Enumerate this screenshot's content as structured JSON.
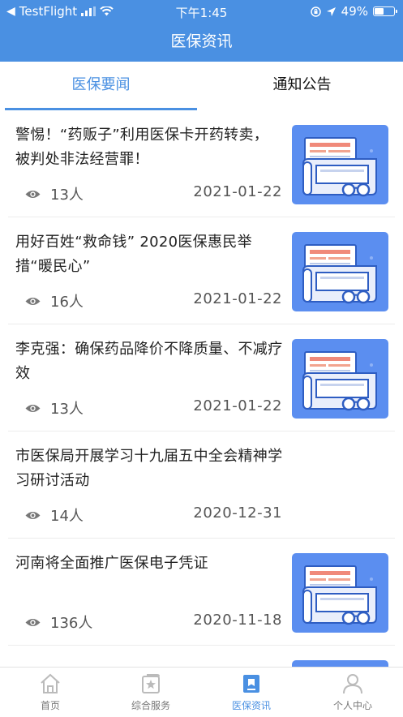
{
  "status_bar": {
    "back_app": "TestFlight",
    "time": "下午1:45",
    "battery": "49%",
    "battery_level": 0.49
  },
  "header": {
    "title": "医保资讯"
  },
  "tabs": [
    {
      "label": "医保要闻",
      "active": true
    },
    {
      "label": "通知公告",
      "active": false
    }
  ],
  "news": [
    {
      "title": "警惕！“药贩子”利用医保卡开药转卖，被判处非法经营罪！",
      "views": "13人",
      "date": "2021-01-22",
      "thumbnail": true
    },
    {
      "title": "用好百姓“救命钱” 2020医保惠民举措“暖民心”",
      "views": "16人",
      "date": "2021-01-22",
      "thumbnail": true
    },
    {
      "title": "李克强：确保药品降价不降质量、不减疗效",
      "views": "13人",
      "date": "2021-01-22",
      "thumbnail": true
    },
    {
      "title": "市医保局开展学习十九届五中全会精神学习研讨活动",
      "views": "14人",
      "date": "2020-12-31",
      "thumbnail": false
    },
    {
      "title": "河南将全面推广医保电子凭证",
      "views": "136人",
      "date": "2020-11-18",
      "thumbnail": true
    }
  ],
  "bottom_nav": [
    {
      "label": "首页",
      "icon": "home-icon",
      "active": false
    },
    {
      "label": "综合服务",
      "icon": "star-card-icon",
      "active": false
    },
    {
      "label": "医保资讯",
      "icon": "bookmark-icon",
      "active": true
    },
    {
      "label": "个人中心",
      "icon": "person-icon",
      "active": false
    }
  ],
  "colors": {
    "primary": "#4a90e2",
    "thumbnail_bg": "#5b8ef0"
  }
}
